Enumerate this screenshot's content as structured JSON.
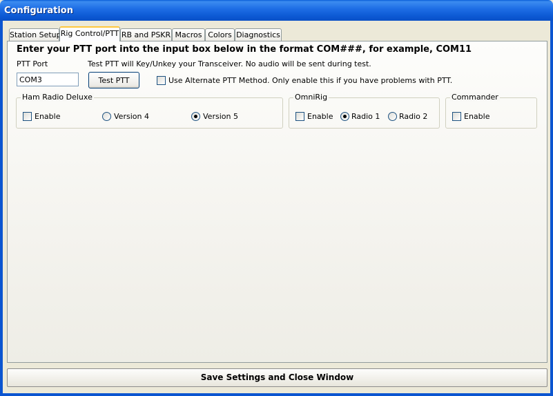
{
  "window": {
    "title": "Configuration"
  },
  "tabs": [
    {
      "label": "Station Setup"
    },
    {
      "label": "Rig Control/PTT"
    },
    {
      "label": "RB and PSKR"
    },
    {
      "label": "Macros"
    },
    {
      "label": "Colors"
    },
    {
      "label": "Diagnostics"
    }
  ],
  "rig": {
    "instruction": "Enter your PTT port into the input box below in the format COM###, for example, COM11",
    "ptt_port_label": "PTT Port",
    "ptt_port_value": "COM3",
    "test_note": "Test PTT will Key/Unkey your Transceiver.  No audio will be sent during test.",
    "test_button": "Test PTT",
    "alt_method_label": "Use Alternate PTT Method.  Only enable this if you have problems with PTT.",
    "alt_method_checked": false
  },
  "hrd": {
    "legend": "Ham Radio Deluxe",
    "enable_label": "Enable",
    "enable_checked": false,
    "version4_label": "Version 4",
    "version5_label": "Version 5",
    "selected_version": "Version 5"
  },
  "omnirig": {
    "legend": "OmniRig",
    "enable_label": "Enable",
    "enable_checked": false,
    "radio1_label": "Radio 1",
    "radio2_label": "Radio 2",
    "selected_radio": "Radio 1"
  },
  "commander": {
    "legend": "Commander",
    "enable_label": "Enable",
    "enable_checked": false
  },
  "footer": {
    "save_button": "Save Settings and Close Window"
  }
}
